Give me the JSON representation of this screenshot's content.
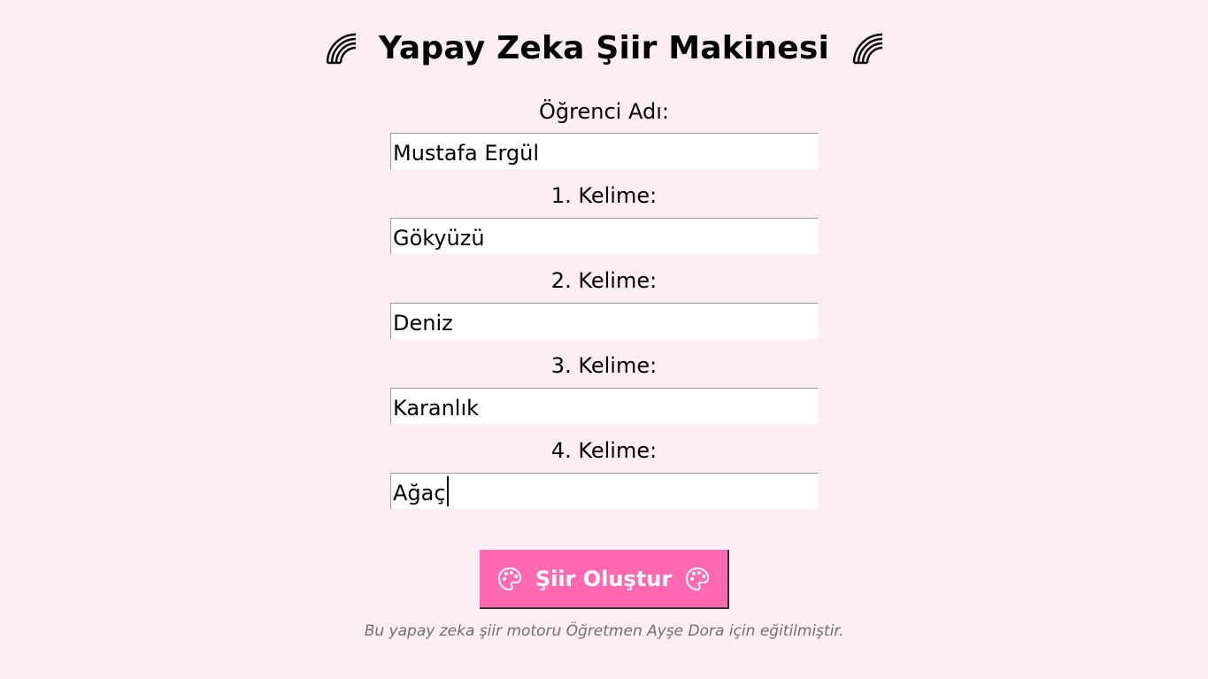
{
  "header": {
    "title": "Yapay Zeka Şiir Makinesi",
    "left_icon": "rainbow-icon",
    "right_icon": "rainbow-icon"
  },
  "form": {
    "student_label": "Öğrenci Adı:",
    "student_value": "Mustafa Ergül",
    "word1_label": "1. Kelime:",
    "word1_value": "Gökyüzü",
    "word2_label": "2. Kelime:",
    "word2_value": "Deniz",
    "word3_label": "3. Kelime:",
    "word3_value": "Karanlık",
    "word4_label": "4. Kelime:",
    "word4_value": "Ağaç"
  },
  "button": {
    "label": "Şiir Oluştur",
    "icon": "palette-icon",
    "color": "#ff69b4"
  },
  "footer": {
    "note": "Bu yapay zeka şiir motoru Öğretmen Ayşe Dora için eğitilmiştir."
  },
  "colors": {
    "background": "#fdeef4",
    "accent": "#ff69b4",
    "footer_text": "#707070"
  }
}
